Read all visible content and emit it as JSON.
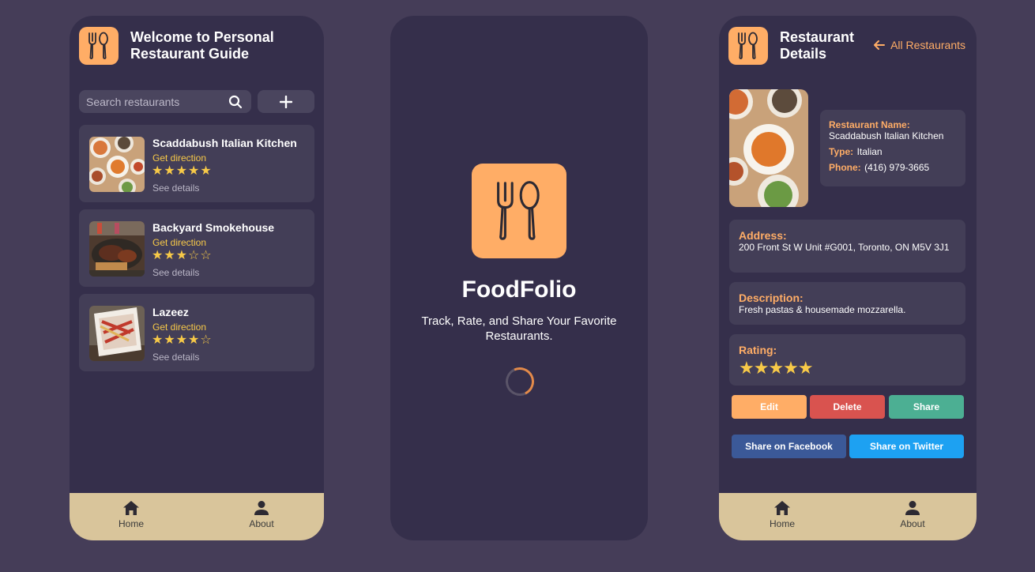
{
  "colors": {
    "background": "#453d58",
    "phone": "#352f4b",
    "card": "#433e57",
    "accent": "#ffad66",
    "star": "#f7c948",
    "tabbar": "#d9c59b",
    "edit": "#ffad66",
    "delete": "#d9534f",
    "share": "#4caf93",
    "facebook": "#3b5998",
    "twitter": "#1da1f2"
  },
  "list_screen": {
    "title": "Welcome to Personal Restaurant Guide",
    "search_placeholder": "Search restaurants",
    "restaurants": [
      {
        "name": "Scaddabush Italian Kitchen",
        "direction": "Get direction",
        "rating": 5,
        "stars": "★★★★★",
        "details": "See details"
      },
      {
        "name": "Backyard Smokehouse",
        "direction": "Get direction",
        "rating": 3,
        "stars": "★★★☆☆",
        "details": "See details"
      },
      {
        "name": "Lazeez",
        "direction": "Get direction",
        "rating": 4,
        "stars": "★★★★☆",
        "details": "See details"
      }
    ]
  },
  "splash_screen": {
    "title": "FoodFolio",
    "subtitle": "Track, Rate, and Share Your Favorite Restaurants."
  },
  "detail_screen": {
    "title": "Restaurant Details",
    "back_label": "All Restaurants",
    "name_label": "Restaurant Name:",
    "name_value": "Scaddabush Italian Kitchen",
    "type_label": "Type:",
    "type_value": "Italian",
    "phone_label": "Phone:",
    "phone_value": "(416) 979-3665",
    "address_label": "Address:",
    "address_value": "200 Front St W Unit #G001, Toronto, ON M5V 3J1",
    "description_label": "Description:",
    "description_value": "Fresh pastas & housemade mozzarella.",
    "rating_label": "Rating:",
    "rating": 5,
    "rating_stars": "★★★★★",
    "edit_label": "Edit",
    "delete_label": "Delete",
    "share_label": "Share",
    "facebook_label": "Share on Facebook",
    "twitter_label": "Share on Twitter"
  },
  "tabbar": {
    "home_label": "Home",
    "about_label": "About"
  },
  "icons": {
    "logo": "fork-spoon-icon",
    "search": "search-icon",
    "add": "plus-icon",
    "back": "arrow-left-icon",
    "home": "home-icon",
    "about": "person-icon"
  }
}
